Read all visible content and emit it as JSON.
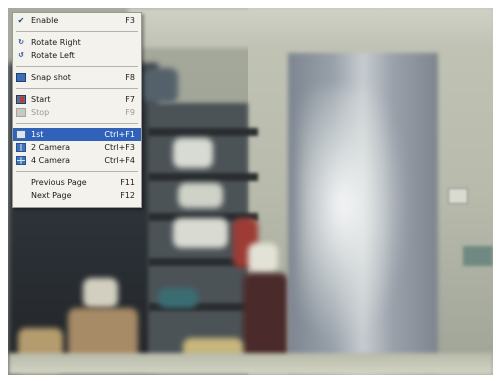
{
  "context_menu": {
    "items": [
      {
        "label": "Enable",
        "shortcut": "F3",
        "icon": "check-icon",
        "state": "checked"
      },
      {
        "label": "Rotate Right",
        "shortcut": "",
        "icon": "rotate-right-icon",
        "state": "normal"
      },
      {
        "label": "Rotate Left",
        "shortcut": "",
        "icon": "rotate-left-icon",
        "state": "normal"
      },
      {
        "label": "Snap shot",
        "shortcut": "F8",
        "icon": "camera-icon",
        "state": "normal"
      },
      {
        "label": "Start",
        "shortcut": "F7",
        "icon": "record-start-icon",
        "state": "normal"
      },
      {
        "label": "Stop",
        "shortcut": "F9",
        "icon": "record-stop-icon",
        "state": "disabled"
      },
      {
        "label": "1st",
        "shortcut": "Ctrl+F1",
        "icon": "single-view-icon",
        "state": "selected"
      },
      {
        "label": "2 Camera",
        "shortcut": "Ctrl+F3",
        "icon": "two-camera-view-icon",
        "state": "normal"
      },
      {
        "label": "4 Camera",
        "shortcut": "Ctrl+F4",
        "icon": "four-camera-view-icon",
        "state": "normal"
      },
      {
        "label": "Previous Page",
        "shortcut": "F11",
        "icon": "",
        "state": "normal"
      },
      {
        "label": "Next Page",
        "shortcut": "F12",
        "icon": "",
        "state": "normal"
      }
    ]
  },
  "colors": {
    "menu_background": "#f3f2ec",
    "selection": "#2f62b8",
    "disabled_text": "#9a9a93"
  }
}
